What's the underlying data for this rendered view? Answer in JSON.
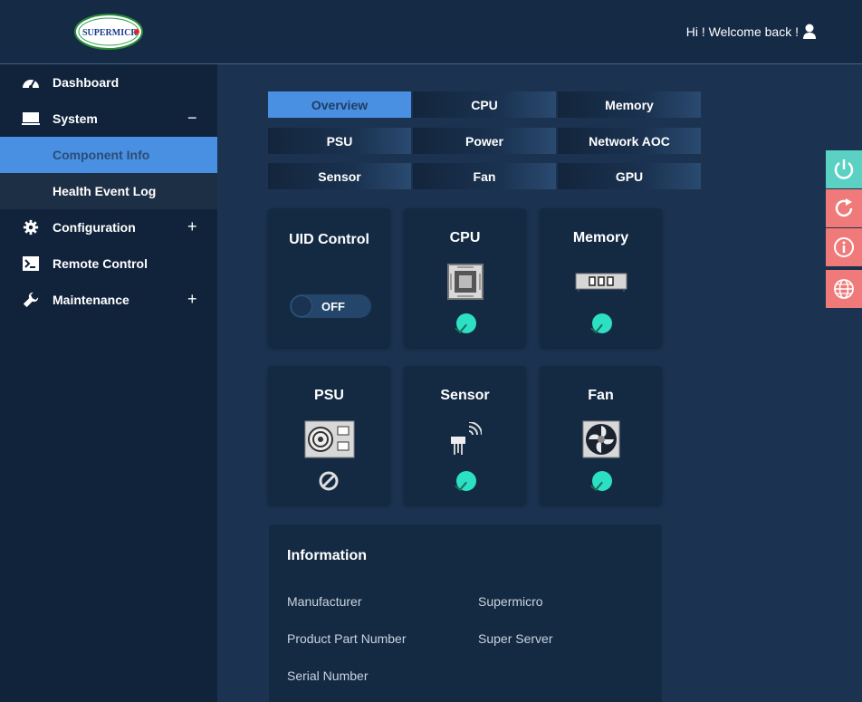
{
  "header": {
    "logo_text": "SUPERMICRO",
    "welcome": "Hi ! Welcome back !"
  },
  "sidebar": {
    "items": [
      {
        "label": "Dashboard",
        "icon": "dashboard-gauge-icon"
      },
      {
        "label": "System",
        "icon": "monitor-icon",
        "toggle": "−"
      },
      {
        "label": "Component Info",
        "sub": true,
        "active": true
      },
      {
        "label": "Health Event Log",
        "sub": true
      },
      {
        "label": "Configuration",
        "icon": "gear-icon",
        "toggle": "+"
      },
      {
        "label": "Remote Control",
        "icon": "terminal-icon"
      },
      {
        "label": "Maintenance",
        "icon": "wrench-icon",
        "toggle": "+"
      }
    ]
  },
  "tabs": [
    "Overview",
    "CPU",
    "Memory",
    "PSU",
    "Power",
    "Network AOC",
    "Sensor",
    "Fan",
    "GPU"
  ],
  "active_tab": "Overview",
  "cards": {
    "uid": {
      "title": "UID Control",
      "state": "OFF"
    },
    "cpu": {
      "title": "CPU",
      "status": "ok"
    },
    "memory": {
      "title": "Memory",
      "status": "ok"
    },
    "psu": {
      "title": "PSU",
      "status": "not-available"
    },
    "sensor": {
      "title": "Sensor",
      "status": "ok"
    },
    "fan": {
      "title": "Fan",
      "status": "ok"
    }
  },
  "information": {
    "title": "Information",
    "rows": [
      {
        "key": "Manufacturer",
        "value": "Supermicro"
      },
      {
        "key": "Product Part Number",
        "value": "Super Server"
      },
      {
        "key": "Serial Number",
        "value": ""
      }
    ]
  },
  "floating_buttons": [
    "power-icon",
    "refresh-icon",
    "info-icon",
    "globe-icon"
  ],
  "colors": {
    "accent": "#4a90e2",
    "status_ok": "#2ce0c4",
    "float_green": "#5ad1c2",
    "float_red": "#f07a7a"
  }
}
